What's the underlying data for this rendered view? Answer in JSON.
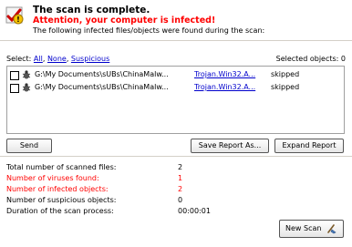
{
  "header": {
    "title": "The scan is complete.",
    "warning": "Attention, your computer is infected!",
    "description": "The following infected files/objects were found during the scan:"
  },
  "selection": {
    "label": "Select:",
    "all": "All",
    "none": "None",
    "suspicious": "Suspicious",
    "selected_label": "Selected objects: 0"
  },
  "results": [
    {
      "path": "G:\\My Documents\\sUBs\\ChinaMalw...",
      "threat": "Trojan.Win32.A...",
      "status": "skipped"
    },
    {
      "path": "G:\\My Documents\\sUBs\\ChinaMalw...",
      "threat": "Trojan.Win32.A...",
      "status": "skipped"
    }
  ],
  "buttons": {
    "send": "Send",
    "save_report": "Save Report As...",
    "expand_report": "Expand Report",
    "new_scan": "New Scan"
  },
  "stats": [
    {
      "label": "Total number of scanned files:",
      "value": "2",
      "alert": false
    },
    {
      "label": "Number of viruses found:",
      "value": "1",
      "alert": true
    },
    {
      "label": "Number of infected objects:",
      "value": "2",
      "alert": true
    },
    {
      "label": "Number of suspicious objects:",
      "value": "0",
      "alert": false
    },
    {
      "label": "Duration of the scan process:",
      "value": "00:00:01",
      "alert": false
    }
  ],
  "colors": {
    "warning": "#ff0000",
    "link": "#0000cc"
  },
  "icons": {
    "header": "warning-shield-icon",
    "row": "bug-icon",
    "new_scan": "broom-icon"
  }
}
